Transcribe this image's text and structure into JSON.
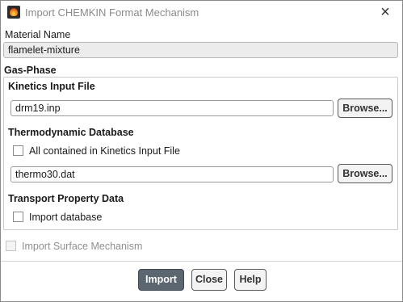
{
  "window": {
    "title": "Import CHEMKIN Format Mechanism",
    "icon": "fluent-flame-icon",
    "close_glyph": "×"
  },
  "material": {
    "label": "Material Name",
    "value": "flamelet-mixture"
  },
  "gas_phase": {
    "heading": "Gas-Phase",
    "kinetics": {
      "heading": "Kinetics Input File",
      "value": "drm19.inp",
      "browse_label": "Browse..."
    },
    "thermo": {
      "heading": "Thermodynamic Database",
      "checkbox_label": "All contained in Kinetics Input File",
      "checked": false,
      "value": "thermo30.dat",
      "browse_label": "Browse..."
    },
    "transport": {
      "heading": "Transport Property Data",
      "checkbox_label": "Import database",
      "checked": false
    }
  },
  "surface": {
    "checkbox_label": "Import Surface Mechanism",
    "checked": false,
    "enabled": false
  },
  "buttons": {
    "import": "Import",
    "close": "Close",
    "help": "Help"
  },
  "colors": {
    "primary_button": "#5b6670",
    "title_text": "#8a8a8a",
    "disabled_text": "#8f8f8f"
  }
}
